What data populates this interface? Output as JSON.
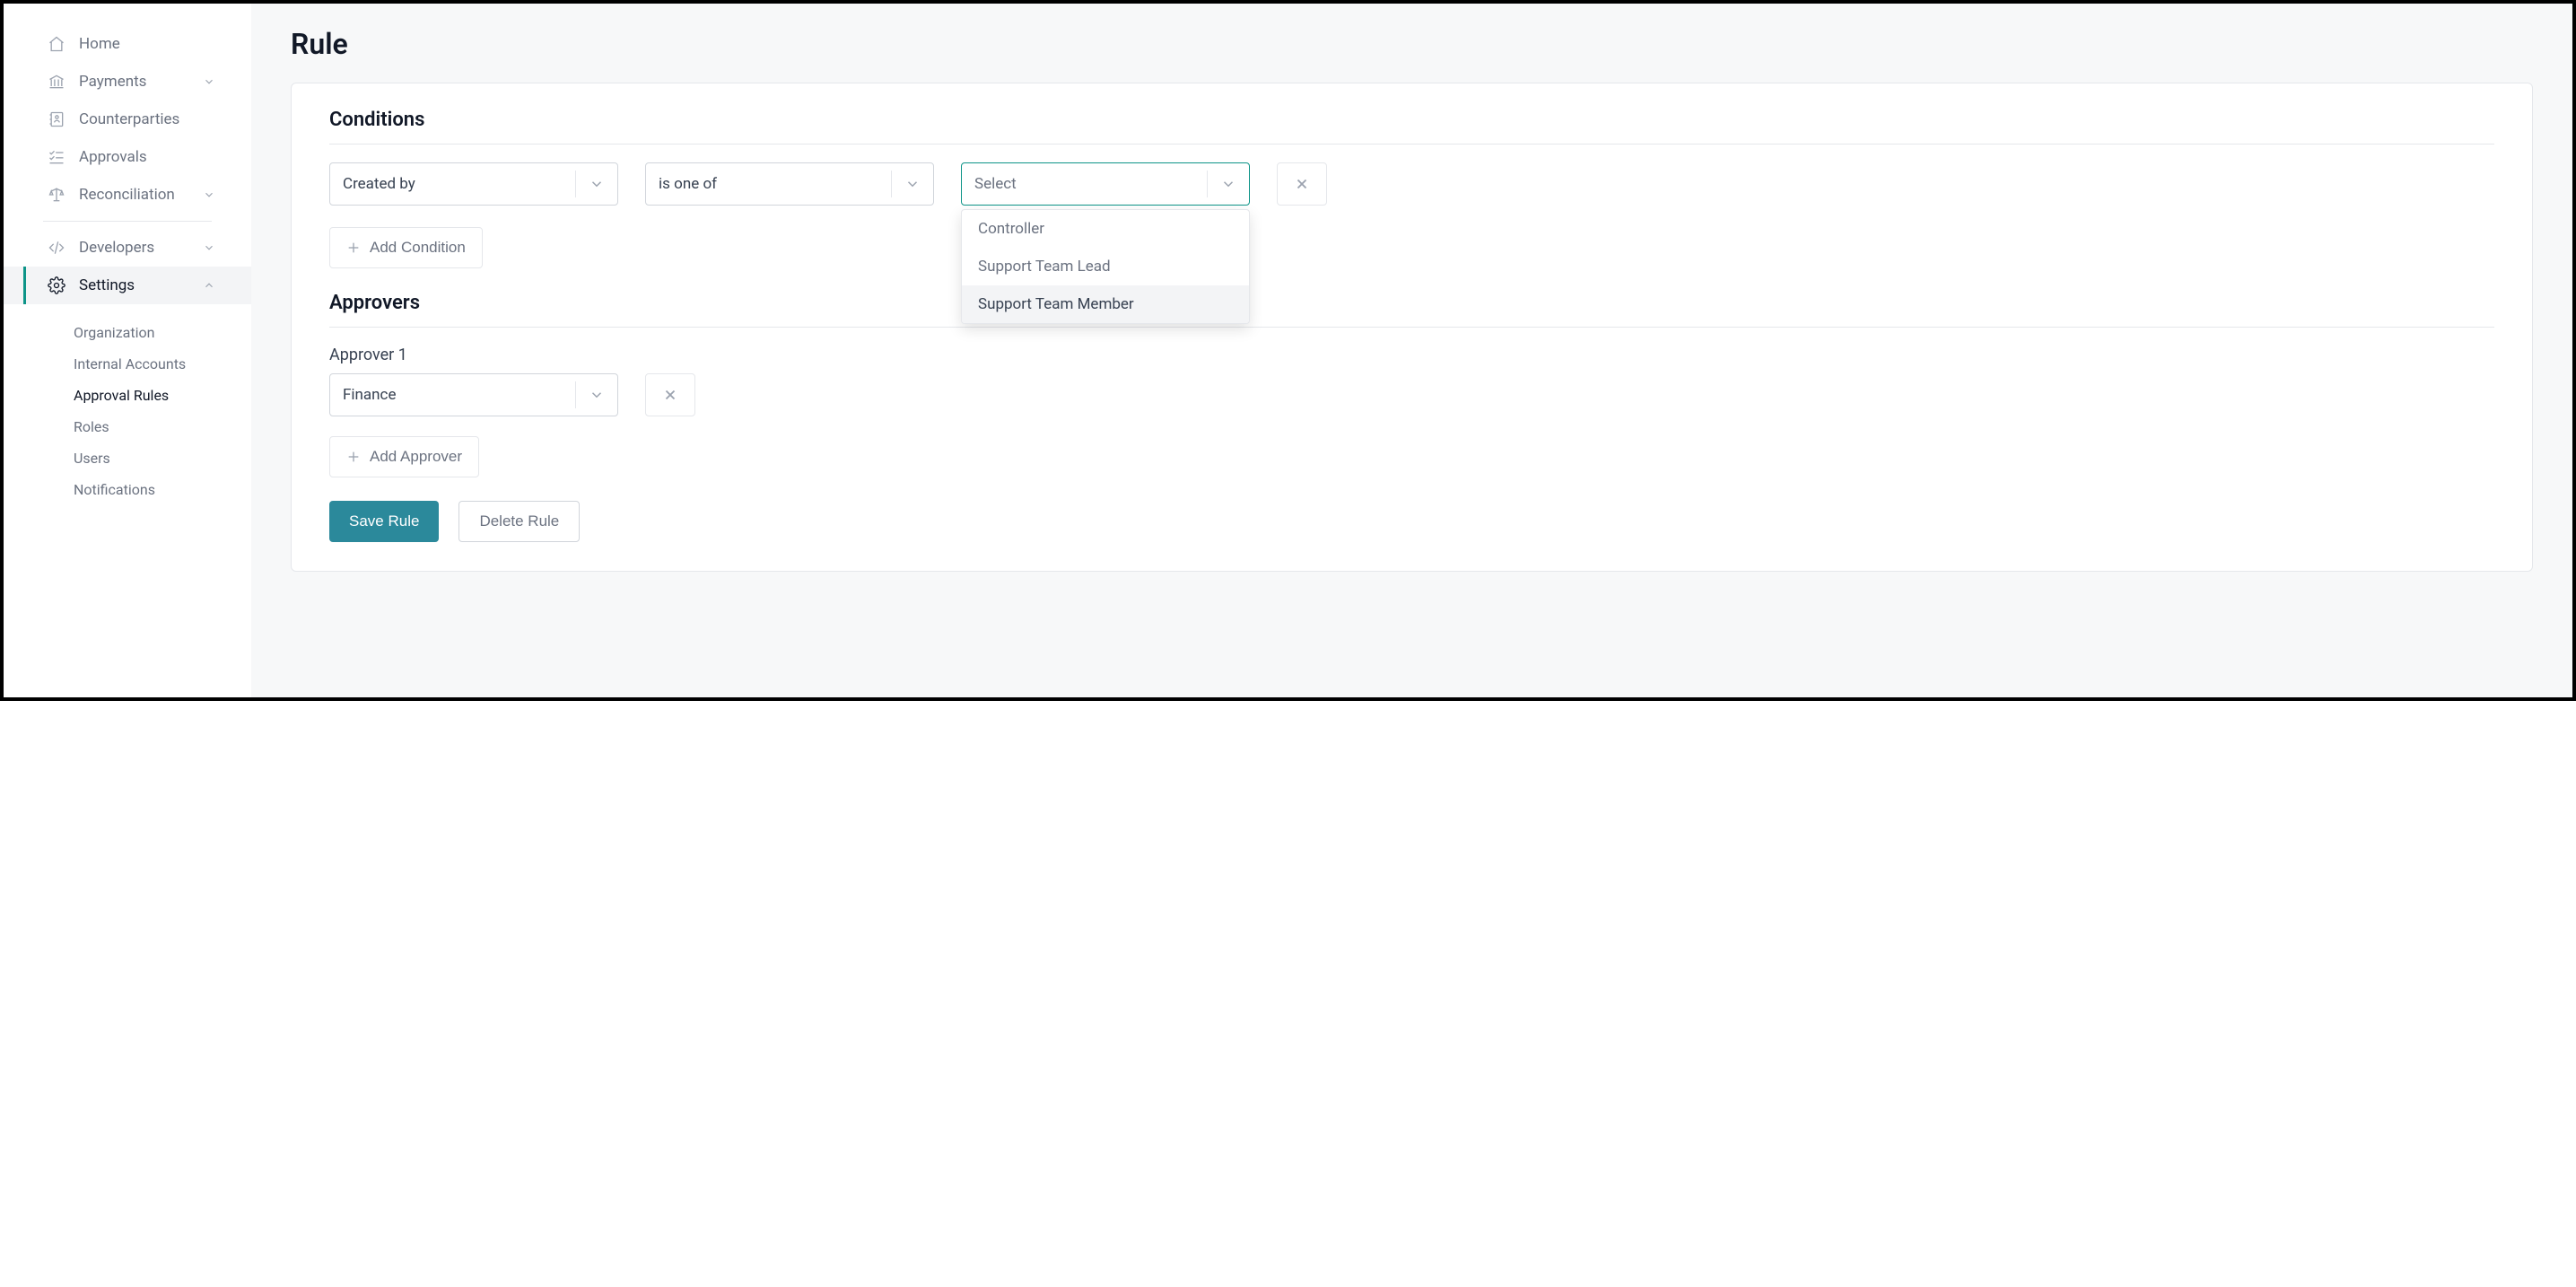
{
  "sidebar": {
    "items": [
      {
        "label": "Home"
      },
      {
        "label": "Payments"
      },
      {
        "label": "Counterparties"
      },
      {
        "label": "Approvals"
      },
      {
        "label": "Reconciliation"
      },
      {
        "label": "Developers"
      },
      {
        "label": "Settings"
      }
    ],
    "settings_sub": [
      {
        "label": "Organization"
      },
      {
        "label": "Internal Accounts"
      },
      {
        "label": "Approval Rules"
      },
      {
        "label": "Roles"
      },
      {
        "label": "Users"
      },
      {
        "label": "Notifications"
      }
    ]
  },
  "page": {
    "title": "Rule"
  },
  "conditions": {
    "heading": "Conditions",
    "field_value": "Created by",
    "operator_value": "is one of",
    "value_placeholder": "Select",
    "value_options": [
      "Controller",
      "Support Team Lead",
      "Support Team Member"
    ],
    "add_label": "Add Condition"
  },
  "approvers": {
    "heading": "Approvers",
    "slot_label": "Approver 1",
    "slot_value": "Finance",
    "add_label": "Add Approver"
  },
  "actions": {
    "save": "Save Rule",
    "delete": "Delete Rule"
  }
}
